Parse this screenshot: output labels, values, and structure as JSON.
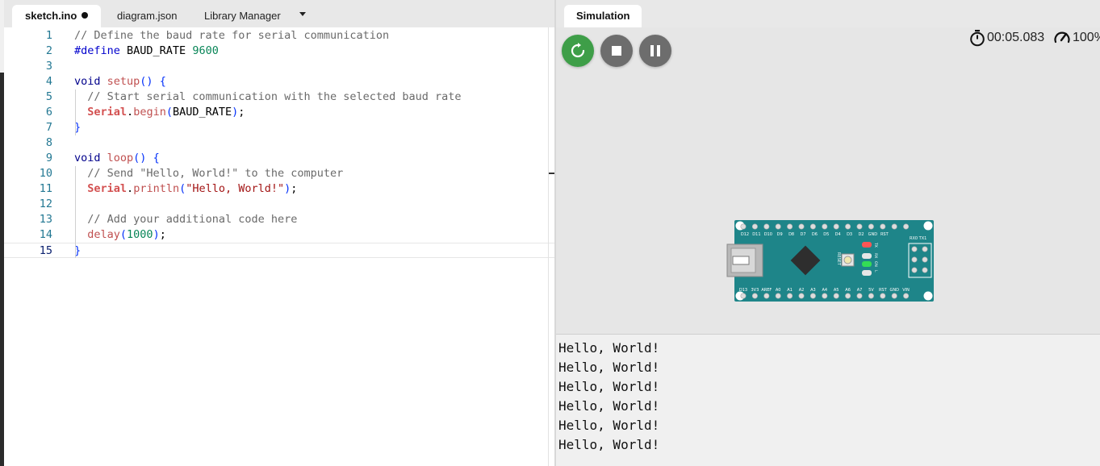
{
  "editor": {
    "tabs": [
      {
        "label": "sketch.ino",
        "modified": true,
        "active": true
      },
      {
        "label": "diagram.json",
        "active": false
      },
      {
        "label": "Library Manager",
        "active": false
      }
    ],
    "current_line": 15,
    "lines": [
      {
        "num": "1",
        "parts": [
          [
            "c-comment",
            "// Define the baud rate for serial communication"
          ]
        ]
      },
      {
        "num": "2",
        "parts": [
          [
            "c-pre",
            "#define"
          ],
          [
            "",
            " BAUD_RATE "
          ],
          [
            "c-num",
            "9600"
          ]
        ]
      },
      {
        "num": "3",
        "parts": []
      },
      {
        "num": "4",
        "parts": [
          [
            "c-kw",
            "void"
          ],
          [
            "",
            " "
          ],
          [
            "c-fn",
            "setup"
          ],
          [
            "c-brace",
            "()"
          ],
          [
            "",
            " "
          ],
          [
            "c-brace",
            "{"
          ]
        ]
      },
      {
        "num": "5",
        "parts": [
          [
            "",
            "  "
          ],
          [
            "c-comment",
            "// Start serial communication with the selected baud rate"
          ]
        ]
      },
      {
        "num": "6",
        "parts": [
          [
            "",
            "  "
          ],
          [
            "c-obj",
            "Serial"
          ],
          [
            "",
            "."
          ],
          [
            "c-fn",
            "begin"
          ],
          [
            "c-brace",
            "("
          ],
          [
            "",
            "BAUD_RATE"
          ],
          [
            "c-brace",
            ")"
          ],
          [
            "",
            ";"
          ]
        ]
      },
      {
        "num": "7",
        "parts": [
          [
            "c-brace",
            "}"
          ]
        ]
      },
      {
        "num": "8",
        "parts": []
      },
      {
        "num": "9",
        "parts": [
          [
            "c-kw",
            "void"
          ],
          [
            "",
            " "
          ],
          [
            "c-fn",
            "loop"
          ],
          [
            "c-brace",
            "()"
          ],
          [
            "",
            " "
          ],
          [
            "c-brace",
            "{"
          ]
        ]
      },
      {
        "num": "10",
        "parts": [
          [
            "",
            "  "
          ],
          [
            "c-comment",
            "// Send \"Hello, World!\" to the computer"
          ]
        ]
      },
      {
        "num": "11",
        "parts": [
          [
            "",
            "  "
          ],
          [
            "c-obj",
            "Serial"
          ],
          [
            "",
            "."
          ],
          [
            "c-fn",
            "println"
          ],
          [
            "c-brace",
            "("
          ],
          [
            "c-str",
            "\"Hello, World!\""
          ],
          [
            "c-brace",
            ")"
          ],
          [
            "",
            ";"
          ]
        ]
      },
      {
        "num": "12",
        "parts": []
      },
      {
        "num": "13",
        "parts": [
          [
            "",
            "  "
          ],
          [
            "c-comment",
            "// Add your additional code here"
          ]
        ]
      },
      {
        "num": "14",
        "parts": [
          [
            "",
            "  "
          ],
          [
            "c-fn",
            "delay"
          ],
          [
            "c-brace",
            "("
          ],
          [
            "c-num",
            "1000"
          ],
          [
            "c-brace",
            ")"
          ],
          [
            "",
            ";"
          ]
        ]
      },
      {
        "num": "15",
        "parts": [
          [
            "c-brace",
            "}"
          ]
        ]
      }
    ]
  },
  "simulation": {
    "tab_label": "Simulation",
    "timer": "00:05.083",
    "speed": "100%",
    "controls": {
      "restart": "restart-icon",
      "stop": "stop-icon",
      "pause": "pause-icon"
    },
    "colors": {
      "restart": "#3e9e48",
      "control": "#6d6d6d",
      "board": "#1e8589"
    },
    "board": {
      "name": "Arduino Nano",
      "top_pin_labels": [
        "D12",
        "D11",
        "D10",
        "D9",
        "D8",
        "D7",
        "D6",
        "D5",
        "D4",
        "D3",
        "D2",
        "GND",
        "RST"
      ],
      "bottom_pin_labels": [
        "D13",
        "3V3",
        "AREF",
        "A0",
        "A1",
        "A2",
        "A3",
        "A4",
        "A5",
        "A6",
        "A7",
        "5V",
        "RST",
        "GND",
        "VIN"
      ],
      "rx_tx_label": "RX0 TX1",
      "reset_label": "RESET",
      "led_labels": [
        "TX",
        "RX",
        "ON",
        "L"
      ]
    }
  },
  "serial_monitor": {
    "lines": [
      "Hello, World!",
      "Hello, World!",
      "Hello, World!",
      "Hello, World!",
      "Hello, World!",
      "Hello, World!"
    ]
  }
}
